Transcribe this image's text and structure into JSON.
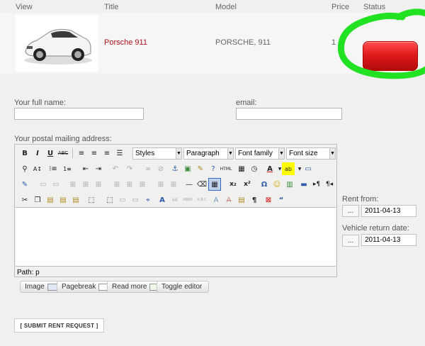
{
  "table": {
    "headers": {
      "view": "View",
      "title": "Title",
      "model": "Model",
      "price": "Price",
      "status": "Status"
    },
    "row": {
      "title": "Porsche 911",
      "model": "PORSCHE, 911",
      "price": "1 -",
      "status_color": "#e01b1b"
    }
  },
  "form": {
    "full_name_label": "Your full name:",
    "full_name_value": "",
    "email_label": "email:",
    "email_value": "",
    "address_label": "Your postal mailing address:"
  },
  "editor": {
    "selects": {
      "styles": "Styles",
      "paragraph": "Paragraph",
      "font_family": "Font family",
      "font_size": "Font size"
    },
    "path": "Path: p",
    "buttons": {
      "image": "Image",
      "pagebreak": "Pagebreak",
      "readmore": "Read more",
      "toggle": "Toggle editor"
    }
  },
  "rental": {
    "rent_from_label": "Rent from:",
    "rent_from_value": "2011-04-13",
    "return_label": "Vehicle return date:",
    "return_value": "2011-04-13",
    "picker_label": "..."
  },
  "submit_label": "[ SUBMIT RENT REQUEST ]",
  "annotation_color": "#22e022"
}
